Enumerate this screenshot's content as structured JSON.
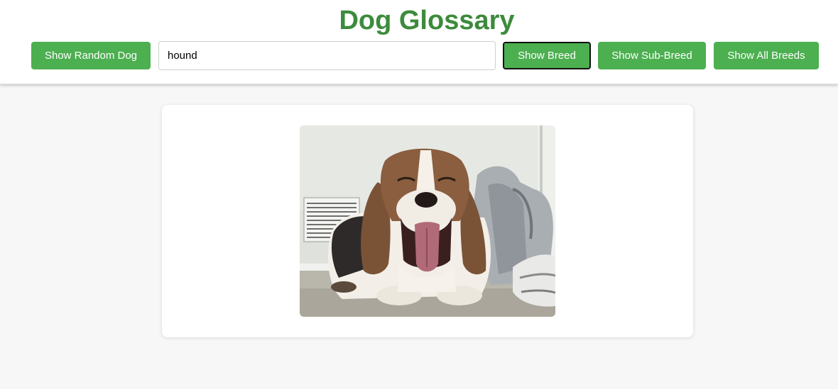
{
  "header": {
    "title": "Dog Glossary",
    "title_color": "#3c8b3c"
  },
  "toolbar": {
    "random_label": "Show Random Dog",
    "breed_input_value": "hound",
    "breed_label": "Show Breed",
    "sub_breed_label": "Show Sub-Breed",
    "all_breeds_label": "Show All Breeds",
    "button_color": "#4caf50",
    "active_button": "Show Breed"
  },
  "main": {
    "image": {
      "subject": "basset hound yawning",
      "alt": "dog-photo"
    }
  }
}
